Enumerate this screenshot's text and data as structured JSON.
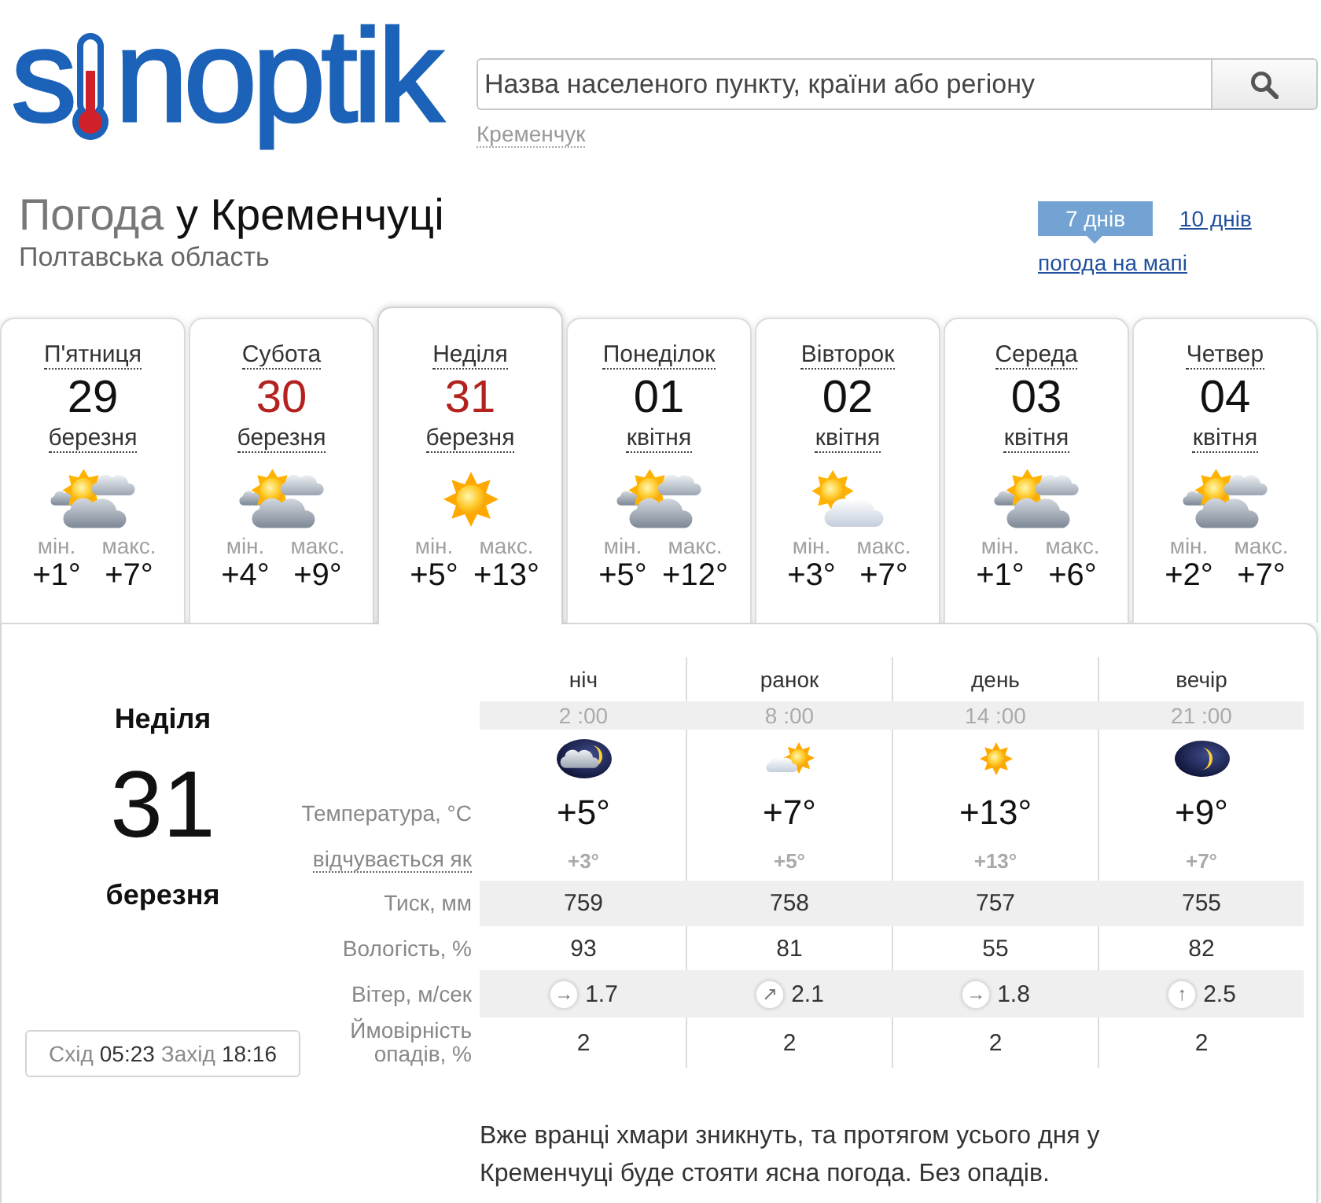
{
  "logo": {
    "text_start": "s",
    "text_end": "noptik"
  },
  "search": {
    "placeholder": "Назва населеного пункту, країни або регіону",
    "recent": "Кременчук"
  },
  "heading": {
    "prefix": "Погода",
    "place": "у Кременчуці",
    "region": "Полтавська область"
  },
  "range_tabs": [
    {
      "label": "7 днів",
      "selected": true
    },
    {
      "label": "10 днів",
      "selected": false
    }
  ],
  "map_link": "погода на мапі",
  "days": [
    {
      "name": "П'ятниця",
      "date": "29",
      "month": "березня",
      "weekend": false,
      "selected": false,
      "kind": "cloudy",
      "min_label": "мін.",
      "min": "+1°",
      "max_label": "макс.",
      "max": "+7°"
    },
    {
      "name": "Субота",
      "date": "30",
      "month": "березня",
      "weekend": true,
      "selected": false,
      "kind": "cloudy",
      "min_label": "мін.",
      "min": "+4°",
      "max_label": "макс.",
      "max": "+9°"
    },
    {
      "name": "Неділя",
      "date": "31",
      "month": "березня",
      "weekend": true,
      "selected": true,
      "kind": "sunny",
      "min_label": "мін.",
      "min": "+5°",
      "max_label": "макс.",
      "max": "+13°"
    },
    {
      "name": "Понеділок",
      "date": "01",
      "month": "квітня",
      "weekend": false,
      "selected": false,
      "kind": "cloudy",
      "min_label": "мін.",
      "min": "+5°",
      "max_label": "макс.",
      "max": "+12°"
    },
    {
      "name": "Вівторок",
      "date": "02",
      "month": "квітня",
      "weekend": false,
      "selected": false,
      "kind": "fair",
      "min_label": "мін.",
      "min": "+3°",
      "max_label": "макс.",
      "max": "+7°"
    },
    {
      "name": "Середа",
      "date": "03",
      "month": "квітня",
      "weekend": false,
      "selected": false,
      "kind": "cloudy",
      "min_label": "мін.",
      "min": "+1°",
      "max_label": "макс.",
      "max": "+6°"
    },
    {
      "name": "Четвер",
      "date": "04",
      "month": "квітня",
      "weekend": false,
      "selected": false,
      "kind": "cloudy",
      "min_label": "мін.",
      "min": "+2°",
      "max_label": "макс.",
      "max": "+7°"
    }
  ],
  "detail": {
    "day": "Неділя",
    "date": "31",
    "month": "березня",
    "sunrise_label": "Схід",
    "sunrise": "05:23",
    "sunset_label": "Захід",
    "sunset": "18:16"
  },
  "row_labels": {
    "temperature": "Температура, °C",
    "feels_like": "відчувається як",
    "pressure": "Тиск, мм",
    "humidity": "Вологість, %",
    "wind": "Вітер, м/сек",
    "precipitation": "Ймовірність опадів, %"
  },
  "periods": [
    {
      "name": "ніч",
      "time": "2 :00",
      "kind": "overcast",
      "temperature": "+5°",
      "feels_like": "+3°",
      "pressure": "759",
      "humidity": "93",
      "wind_arrow": "→",
      "wind": "1.7",
      "precipitation": "2"
    },
    {
      "name": "ранок",
      "time": "8 :00",
      "kind": "partsun",
      "temperature": "+7°",
      "feels_like": "+5°",
      "pressure": "758",
      "humidity": "81",
      "wind_arrow": "↗",
      "wind": "2.1",
      "precipitation": "2"
    },
    {
      "name": "день",
      "time": "14 :00",
      "kind": "sunny",
      "temperature": "+13°",
      "feels_like": "+13°",
      "pressure": "757",
      "humidity": "55",
      "wind_arrow": "→",
      "wind": "1.8",
      "precipitation": "2"
    },
    {
      "name": "вечір",
      "time": "21 :00",
      "kind": "moonlit",
      "temperature": "+9°",
      "feels_like": "+7°",
      "pressure": "755",
      "humidity": "82",
      "wind_arrow": "↑",
      "wind": "2.5",
      "precipitation": "2"
    }
  ],
  "description": "Вже вранці хмари зникнуть, та протягом усього дня у Кременчуці буде стояти ясна погода. Без опадів."
}
